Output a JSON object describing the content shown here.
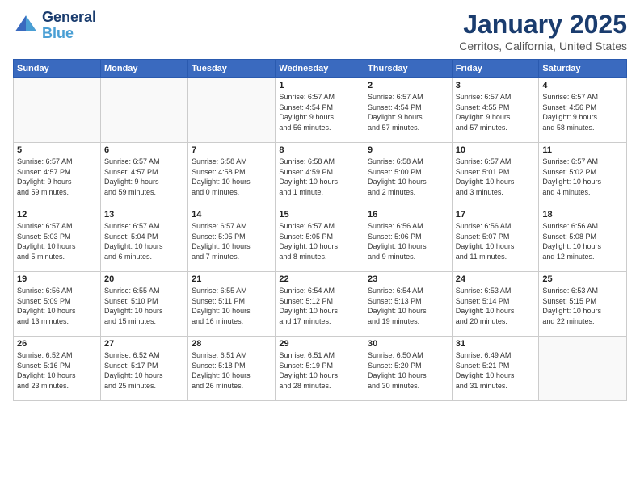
{
  "logo": {
    "text_general": "General",
    "text_blue": "Blue"
  },
  "header": {
    "title": "January 2025",
    "subtitle": "Cerritos, California, United States"
  },
  "days_of_week": [
    "Sunday",
    "Monday",
    "Tuesday",
    "Wednesday",
    "Thursday",
    "Friday",
    "Saturday"
  ],
  "weeks": [
    [
      {
        "day": "",
        "info": ""
      },
      {
        "day": "",
        "info": ""
      },
      {
        "day": "",
        "info": ""
      },
      {
        "day": "1",
        "info": "Sunrise: 6:57 AM\nSunset: 4:54 PM\nDaylight: 9 hours\nand 56 minutes."
      },
      {
        "day": "2",
        "info": "Sunrise: 6:57 AM\nSunset: 4:54 PM\nDaylight: 9 hours\nand 57 minutes."
      },
      {
        "day": "3",
        "info": "Sunrise: 6:57 AM\nSunset: 4:55 PM\nDaylight: 9 hours\nand 57 minutes."
      },
      {
        "day": "4",
        "info": "Sunrise: 6:57 AM\nSunset: 4:56 PM\nDaylight: 9 hours\nand 58 minutes."
      }
    ],
    [
      {
        "day": "5",
        "info": "Sunrise: 6:57 AM\nSunset: 4:57 PM\nDaylight: 9 hours\nand 59 minutes."
      },
      {
        "day": "6",
        "info": "Sunrise: 6:57 AM\nSunset: 4:57 PM\nDaylight: 9 hours\nand 59 minutes."
      },
      {
        "day": "7",
        "info": "Sunrise: 6:58 AM\nSunset: 4:58 PM\nDaylight: 10 hours\nand 0 minutes."
      },
      {
        "day": "8",
        "info": "Sunrise: 6:58 AM\nSunset: 4:59 PM\nDaylight: 10 hours\nand 1 minute."
      },
      {
        "day": "9",
        "info": "Sunrise: 6:58 AM\nSunset: 5:00 PM\nDaylight: 10 hours\nand 2 minutes."
      },
      {
        "day": "10",
        "info": "Sunrise: 6:57 AM\nSunset: 5:01 PM\nDaylight: 10 hours\nand 3 minutes."
      },
      {
        "day": "11",
        "info": "Sunrise: 6:57 AM\nSunset: 5:02 PM\nDaylight: 10 hours\nand 4 minutes."
      }
    ],
    [
      {
        "day": "12",
        "info": "Sunrise: 6:57 AM\nSunset: 5:03 PM\nDaylight: 10 hours\nand 5 minutes."
      },
      {
        "day": "13",
        "info": "Sunrise: 6:57 AM\nSunset: 5:04 PM\nDaylight: 10 hours\nand 6 minutes."
      },
      {
        "day": "14",
        "info": "Sunrise: 6:57 AM\nSunset: 5:05 PM\nDaylight: 10 hours\nand 7 minutes."
      },
      {
        "day": "15",
        "info": "Sunrise: 6:57 AM\nSunset: 5:05 PM\nDaylight: 10 hours\nand 8 minutes."
      },
      {
        "day": "16",
        "info": "Sunrise: 6:56 AM\nSunset: 5:06 PM\nDaylight: 10 hours\nand 9 minutes."
      },
      {
        "day": "17",
        "info": "Sunrise: 6:56 AM\nSunset: 5:07 PM\nDaylight: 10 hours\nand 11 minutes."
      },
      {
        "day": "18",
        "info": "Sunrise: 6:56 AM\nSunset: 5:08 PM\nDaylight: 10 hours\nand 12 minutes."
      }
    ],
    [
      {
        "day": "19",
        "info": "Sunrise: 6:56 AM\nSunset: 5:09 PM\nDaylight: 10 hours\nand 13 minutes."
      },
      {
        "day": "20",
        "info": "Sunrise: 6:55 AM\nSunset: 5:10 PM\nDaylight: 10 hours\nand 15 minutes."
      },
      {
        "day": "21",
        "info": "Sunrise: 6:55 AM\nSunset: 5:11 PM\nDaylight: 10 hours\nand 16 minutes."
      },
      {
        "day": "22",
        "info": "Sunrise: 6:54 AM\nSunset: 5:12 PM\nDaylight: 10 hours\nand 17 minutes."
      },
      {
        "day": "23",
        "info": "Sunrise: 6:54 AM\nSunset: 5:13 PM\nDaylight: 10 hours\nand 19 minutes."
      },
      {
        "day": "24",
        "info": "Sunrise: 6:53 AM\nSunset: 5:14 PM\nDaylight: 10 hours\nand 20 minutes."
      },
      {
        "day": "25",
        "info": "Sunrise: 6:53 AM\nSunset: 5:15 PM\nDaylight: 10 hours\nand 22 minutes."
      }
    ],
    [
      {
        "day": "26",
        "info": "Sunrise: 6:52 AM\nSunset: 5:16 PM\nDaylight: 10 hours\nand 23 minutes."
      },
      {
        "day": "27",
        "info": "Sunrise: 6:52 AM\nSunset: 5:17 PM\nDaylight: 10 hours\nand 25 minutes."
      },
      {
        "day": "28",
        "info": "Sunrise: 6:51 AM\nSunset: 5:18 PM\nDaylight: 10 hours\nand 26 minutes."
      },
      {
        "day": "29",
        "info": "Sunrise: 6:51 AM\nSunset: 5:19 PM\nDaylight: 10 hours\nand 28 minutes."
      },
      {
        "day": "30",
        "info": "Sunrise: 6:50 AM\nSunset: 5:20 PM\nDaylight: 10 hours\nand 30 minutes."
      },
      {
        "day": "31",
        "info": "Sunrise: 6:49 AM\nSunset: 5:21 PM\nDaylight: 10 hours\nand 31 minutes."
      },
      {
        "day": "",
        "info": ""
      }
    ]
  ]
}
